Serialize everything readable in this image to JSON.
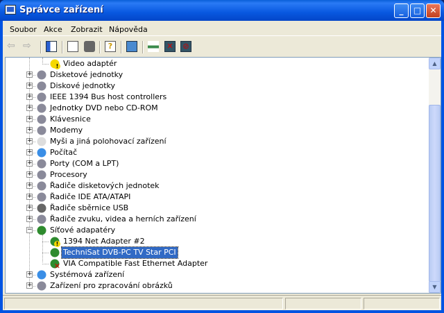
{
  "window": {
    "title": "Správce zařízení"
  },
  "menu": [
    "Soubor",
    "Akce",
    "Zobrazit",
    "Nápověda"
  ],
  "toolbar": [
    "back-icon",
    "forward-icon",
    "show-hide-console-tree-icon",
    "properties-icon",
    "print-icon",
    "help-icon",
    "scan-hardware-icon",
    "update-driver-icon",
    "uninstall-icon",
    "disable-icon"
  ],
  "tree": [
    {
      "label": "Video adaptér",
      "level": 2,
      "icon": "warning-display-icon"
    },
    {
      "label": "Disketové jednotky",
      "level": 1,
      "expander": "+",
      "icon": "floppy-icon"
    },
    {
      "label": "Diskové jednotky",
      "level": 1,
      "expander": "+",
      "icon": "disk-drive-icon"
    },
    {
      "label": "IEEE 1394 Bus host controllers",
      "level": 1,
      "expander": "+",
      "icon": "ieee1394-icon"
    },
    {
      "label": "Jednotky DVD nebo CD-ROM",
      "level": 1,
      "expander": "+",
      "icon": "cdrom-icon"
    },
    {
      "label": "Klávesnice",
      "level": 1,
      "expander": "+",
      "icon": "keyboard-icon"
    },
    {
      "label": "Modemy",
      "level": 1,
      "expander": "+",
      "icon": "modem-icon"
    },
    {
      "label": "Myši a jiná polohovací zařízení",
      "level": 1,
      "expander": "+",
      "icon": "mouse-icon"
    },
    {
      "label": "Počítač",
      "level": 1,
      "expander": "+",
      "icon": "computer-icon"
    },
    {
      "label": "Porty (COM a LPT)",
      "level": 1,
      "expander": "+",
      "icon": "port-icon"
    },
    {
      "label": "Procesory",
      "level": 1,
      "expander": "+",
      "icon": "processor-icon"
    },
    {
      "label": "Řadiče disketových jednotek",
      "level": 1,
      "expander": "+",
      "icon": "floppy-controller-icon"
    },
    {
      "label": "Řadiče IDE ATA/ATAPI",
      "level": 1,
      "expander": "+",
      "icon": "ide-controller-icon"
    },
    {
      "label": "Řadiče sběrnice USB",
      "level": 1,
      "expander": "+",
      "icon": "usb-icon"
    },
    {
      "label": "Řadiče zvuku, videa a herních zařízení",
      "level": 1,
      "expander": "+",
      "icon": "sound-icon"
    },
    {
      "label": "Síťové adapatéry",
      "level": 1,
      "expander": "−",
      "icon": "network-adapter-icon"
    },
    {
      "label": "1394 Net Adapter #2",
      "level": 2,
      "icon": "network-adapter-warning-icon"
    },
    {
      "label": "TechniSat DVB-PC TV Star PCI",
      "level": 2,
      "icon": "network-adapter-icon",
      "selected": true
    },
    {
      "label": "VIA Compatible Fast Ethernet Adapter",
      "level": 2,
      "icon": "network-adapter-disabled-icon"
    },
    {
      "label": "Systémová zařízení",
      "level": 1,
      "expander": "+",
      "icon": "system-device-icon"
    },
    {
      "label": "Zařízení pro zpracování obrázků",
      "level": 1,
      "expander": "+",
      "icon": "imaging-device-icon"
    }
  ],
  "colors": {
    "selection": "#316ac5",
    "titlebar": "#0858e0"
  }
}
